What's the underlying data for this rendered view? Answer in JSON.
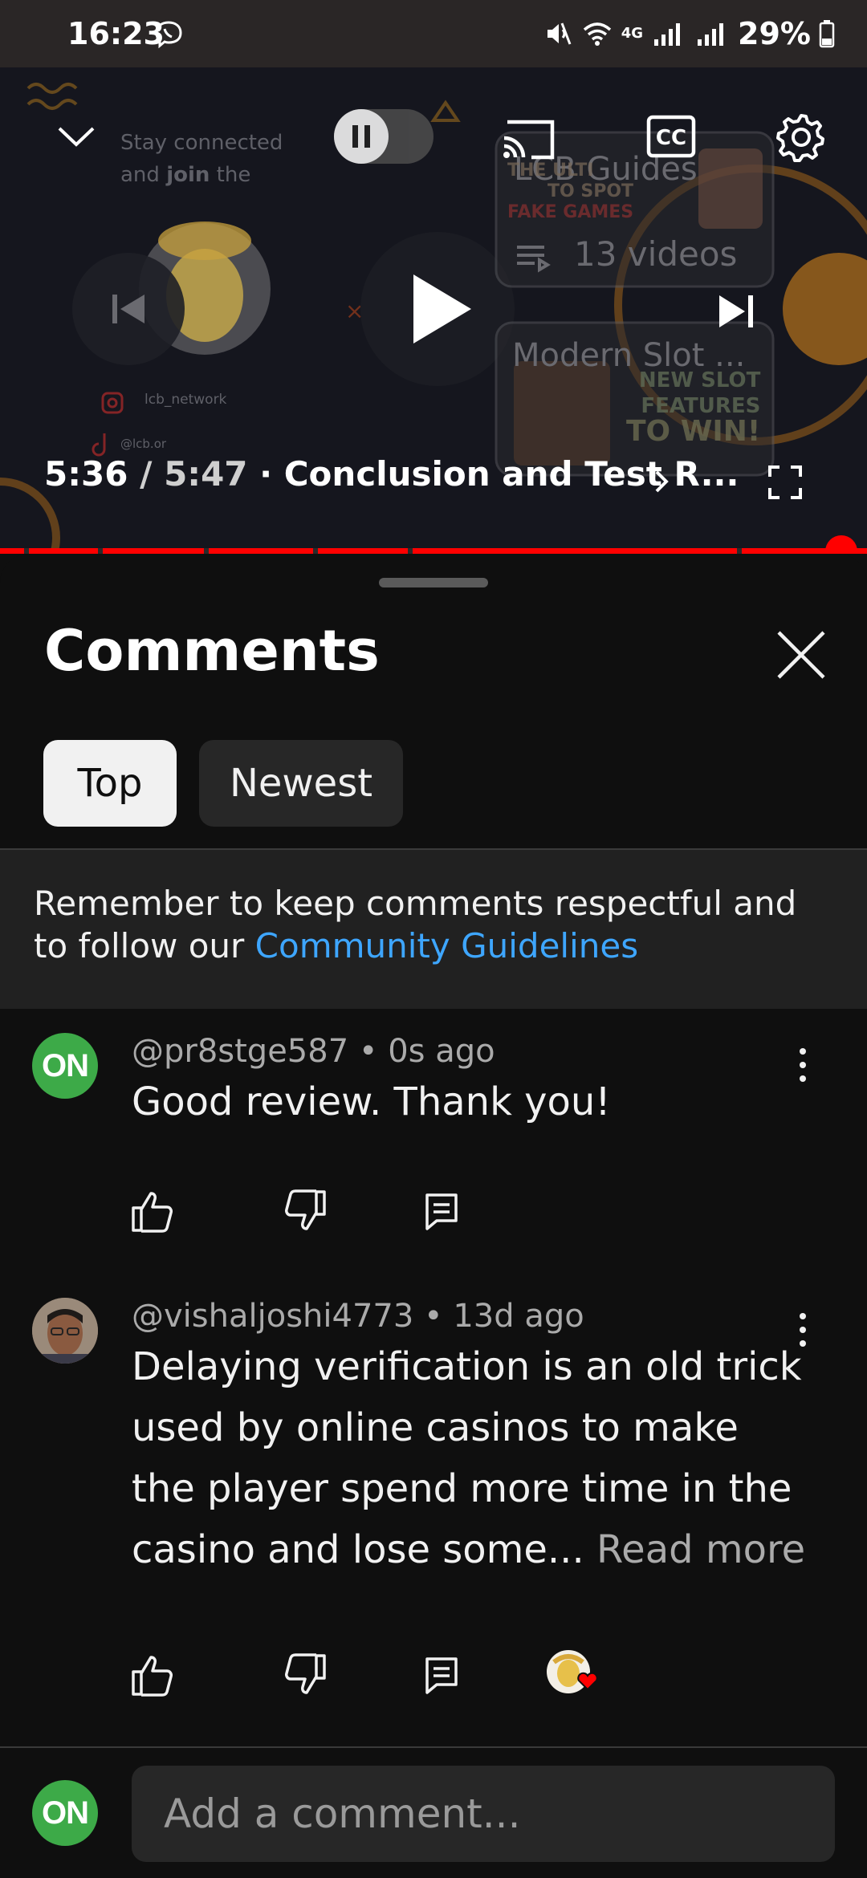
{
  "status_bar": {
    "time": "16:23",
    "network": "4G",
    "battery": "29%"
  },
  "player": {
    "overlay_text": {
      "stay_line1": "Stay connected",
      "stay_line2_pre": "and ",
      "stay_line2_bold": "join",
      "stay_line2_post": " the",
      "social_handle": "lcb_network",
      "social_site": "@lcb.or",
      "card1_title": "LCB Guides",
      "card1_count": "13 videos",
      "card1_art_line1": "THE ULTI",
      "card1_art_line2": "TO SPOT",
      "card1_art_line3": "FAKE GAMES",
      "card2_title": "Modern Slot ...",
      "card2_art_line1": "NEW SLOT",
      "card2_art_line2": "FEATURES",
      "card2_art_line3": "TO WIN!"
    },
    "current_time": "5:36",
    "duration": "5:47",
    "chapter": "Conclusion and Test R...",
    "progress": 0.97,
    "accent": "#ff0000"
  },
  "comments_panel": {
    "title": "Comments",
    "filters": [
      "Top",
      "Newest"
    ],
    "selected_filter": "Top",
    "notice_text": "Remember to keep comments respectful and to follow our ",
    "notice_link": "Community Guidelines",
    "link_color": "#3ea6ff",
    "comments": [
      {
        "avatar_text": "ON",
        "author": "@pr8stge587",
        "age": "0s ago",
        "text": "Good review. Thank you!"
      },
      {
        "author": "@vishaljoshi4773",
        "age": "13d ago",
        "text": "Delaying verification is an old trick used by online casinos to make the player spend more time in the casino and lose some...",
        "read_more": "Read more"
      }
    ],
    "input": {
      "avatar_text": "ON",
      "placeholder": "Add a comment..."
    }
  }
}
